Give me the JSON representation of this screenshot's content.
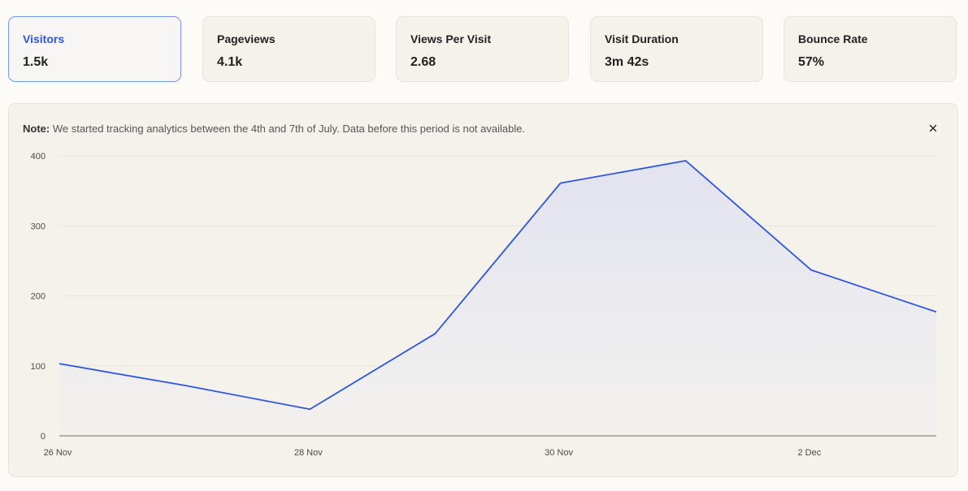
{
  "metrics": [
    {
      "label": "Visitors",
      "value": "1.5k",
      "active": true
    },
    {
      "label": "Pageviews",
      "value": "4.1k",
      "active": false
    },
    {
      "label": "Views Per Visit",
      "value": "2.68",
      "active": false
    },
    {
      "label": "Visit Duration",
      "value": "3m 42s",
      "active": false
    },
    {
      "label": "Bounce Rate",
      "value": "57%",
      "active": false
    }
  ],
  "note": {
    "prefix": "Note:",
    "text": " We started tracking analytics between the 4th and 7th of July. Data before this period is not available."
  },
  "icons": {
    "close": "close-icon"
  },
  "colors": {
    "accent": "#2f56de",
    "fill_top": "#e2e3f0",
    "fill_bottom": "#f3f1ee"
  },
  "chart_data": {
    "type": "area",
    "x": [
      "26 Nov",
      "27 Nov",
      "28 Nov",
      "29 Nov",
      "30 Nov",
      "1 Dec",
      "2 Dec",
      "3 Dec"
    ],
    "x_tick_labels": [
      "26 Nov",
      "28 Nov",
      "30 Nov",
      "2 Dec"
    ],
    "series": [
      {
        "values": [
          103,
          72,
          38,
          146,
          361,
          393,
          237,
          177
        ]
      }
    ],
    "ylim": [
      0,
      400
    ],
    "y_ticks": [
      0,
      100,
      200,
      300,
      400
    ],
    "grid": true,
    "legend": "none"
  }
}
